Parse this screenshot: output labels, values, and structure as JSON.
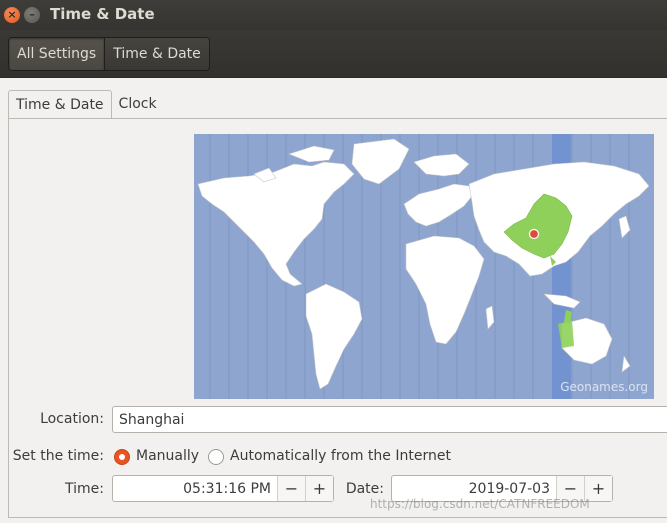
{
  "window": {
    "title": "Time & Date",
    "close_glyph": "×",
    "minimize_glyph": "–"
  },
  "breadcrumb": {
    "items": [
      {
        "label": "All Settings"
      },
      {
        "label": "Time & Date"
      }
    ]
  },
  "tabs": [
    {
      "label": "Time & Date",
      "active": true
    },
    {
      "label": "Clock",
      "active": false
    }
  ],
  "map": {
    "credit": "Geonames.org",
    "selected_city_marker": "red pin",
    "ocean_color": "#8ea6cf",
    "highlight_color": "#8fd05a"
  },
  "location": {
    "label": "Location:",
    "value": "Shanghai"
  },
  "set_time": {
    "label": "Set the time:",
    "options": [
      {
        "label": "Manually",
        "selected": true
      },
      {
        "label": "Automatically from the Internet",
        "selected": false
      }
    ]
  },
  "time_field": {
    "label": "Time:",
    "value": "05:31:16 PM",
    "minus": "−",
    "plus": "+"
  },
  "date_field": {
    "label": "Date:",
    "value": "2019-07-03",
    "minus": "−",
    "plus": "+"
  },
  "watermark": "https://blog.csdn.net/CATNFREEDOM",
  "colors": {
    "accent": "#e95420",
    "titlebar": "#3c3b37"
  }
}
